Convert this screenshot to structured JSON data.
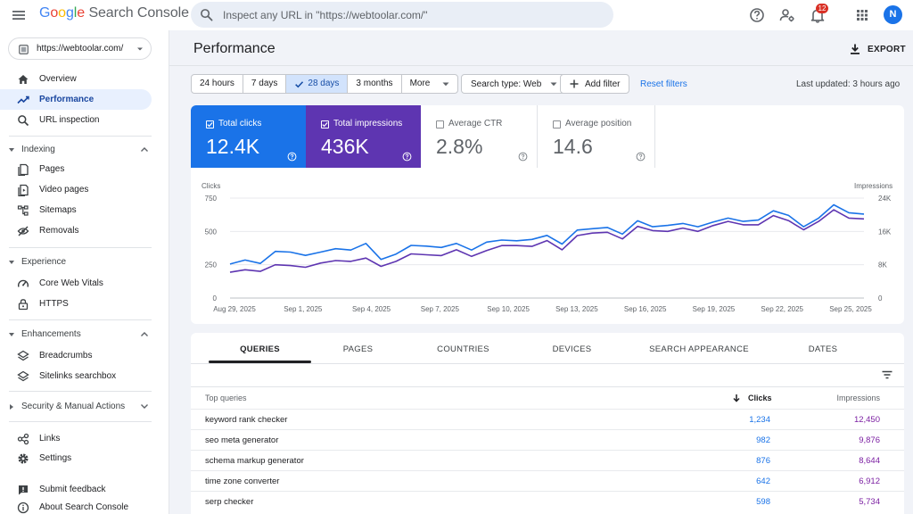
{
  "header": {
    "logo_google": "Google",
    "logo_product": "Search Console",
    "search_placeholder": "Inspect any URL in \"https://webtoolar.com/\"",
    "notification_count": "12",
    "avatar_initial": "N",
    "icons": [
      "menu-icon",
      "search-icon",
      "help-icon",
      "manage-users-icon",
      "bell-icon",
      "apps-grid-icon"
    ]
  },
  "sidebar": {
    "property": "https://webtoolar.com/",
    "top_items": [
      {
        "label": "Overview",
        "icon": "home-icon"
      },
      {
        "label": "Performance",
        "icon": "trending-icon",
        "active": true
      },
      {
        "label": "URL inspection",
        "icon": "search-icon"
      }
    ],
    "sections": [
      {
        "label": "Indexing",
        "items": [
          {
            "label": "Pages",
            "icon": "pages-icon"
          },
          {
            "label": "Video pages",
            "icon": "video-pages-icon"
          },
          {
            "label": "Sitemaps",
            "icon": "sitemap-icon"
          },
          {
            "label": "Removals",
            "icon": "removals-icon"
          }
        ]
      },
      {
        "label": "Experience",
        "items": [
          {
            "label": "Core Web Vitals",
            "icon": "speed-icon"
          },
          {
            "label": "HTTPS",
            "icon": "lock-icon"
          }
        ]
      },
      {
        "label": "Enhancements",
        "items": [
          {
            "label": "Breadcrumbs",
            "icon": "layers-icon"
          },
          {
            "label": "Sitelinks searchbox",
            "icon": "layers-icon"
          }
        ]
      },
      {
        "label": "Security & Manual Actions",
        "items": []
      }
    ],
    "bottom_items": [
      {
        "label": "Links",
        "icon": "links-icon"
      },
      {
        "label": "Settings",
        "icon": "gear-icon"
      }
    ],
    "footer_items": [
      {
        "label": "Submit feedback",
        "icon": "feedback-icon"
      },
      {
        "label": "About Search Console",
        "icon": "info-icon"
      }
    ]
  },
  "main": {
    "title": "Performance",
    "export_label": "EXPORT",
    "date_ranges": [
      "24 hours",
      "7 days",
      "28 days",
      "3 months",
      "More"
    ],
    "selected_range": "28 days",
    "search_type": "Search type: Web",
    "add_filter": "Add filter",
    "reset_filters": "Reset filters",
    "last_updated": "Last updated: 3 hours ago"
  },
  "metrics": [
    {
      "label": "Total clicks",
      "value": "12.4K",
      "checked": true,
      "color": "#1a73e8"
    },
    {
      "label": "Total impressions",
      "value": "436K",
      "checked": true,
      "color": "#5e35b1"
    },
    {
      "label": "Average CTR",
      "value": "2.8%",
      "checked": false,
      "color": ""
    },
    {
      "label": "Average position",
      "value": "14.6",
      "checked": false,
      "color": ""
    }
  ],
  "chart_data": {
    "type": "line",
    "left_axis_title": "Clicks",
    "right_axis_title": "Impressions",
    "left_ticks": [
      "750",
      "500",
      "250",
      "0"
    ],
    "left_ylim": [
      0,
      750
    ],
    "right_ticks": [
      "24K",
      "16K",
      "8K",
      "0"
    ],
    "right_ylim": [
      0,
      24000
    ],
    "x_labels": [
      "Aug 29, 2025",
      "Sep 1, 2025",
      "Sep 4, 2025",
      "Sep 7, 2025",
      "Sep 10, 2025",
      "Sep 13, 2025",
      "Sep 16, 2025",
      "Sep 19, 2025",
      "Sep 22, 2025",
      "Sep 25, 2025"
    ],
    "x": [
      "Aug 29, 2025",
      "Aug 30, 2025",
      "Aug 31, 2025",
      "Sep 1, 2025",
      "Sep 2, 2025",
      "Sep 3, 2025",
      "Sep 4, 2025",
      "Sep 5, 2025",
      "Sep 6, 2025",
      "Sep 7, 2025",
      "Sep 8, 2025",
      "Sep 9, 2025",
      "Sep 10, 2025",
      "Sep 11, 2025",
      "Sep 12, 2025",
      "Sep 13, 2025",
      "Sep 14, 2025",
      "Sep 15, 2025",
      "Sep 16, 2025",
      "Sep 17, 2025",
      "Sep 18, 2025",
      "Sep 19, 2025",
      "Sep 20, 2025",
      "Sep 21, 2025",
      "Sep 22, 2025",
      "Sep 23, 2025",
      "Sep 24, 2025",
      "Sep 25, 2025",
      "Sep 26, 2025"
    ],
    "series": [
      {
        "name": "Clicks",
        "axis": "left",
        "color": "#1a73e8",
        "values": [
          255,
          285,
          260,
          350,
          345,
          320,
          345,
          370,
          360,
          410,
          290,
          330,
          395,
          390,
          380,
          410,
          360,
          420,
          435,
          430,
          440,
          470,
          405,
          510,
          520,
          530,
          480,
          580,
          535,
          545,
          560,
          535,
          570,
          600,
          575,
          585,
          655,
          620,
          535,
          600,
          700,
          640,
          630
        ]
      },
      {
        "name": "Impressions",
        "axis": "right",
        "color": "#5e35b1",
        "values": [
          6200,
          6800,
          6400,
          8000,
          7800,
          7400,
          8400,
          9000,
          8800,
          9600,
          7600,
          8800,
          10600,
          10400,
          10200,
          11600,
          10000,
          11400,
          12600,
          12600,
          12400,
          13800,
          11600,
          15000,
          15600,
          15800,
          14200,
          17200,
          16200,
          16000,
          16800,
          16000,
          17400,
          18400,
          17600,
          17600,
          19800,
          18600,
          16400,
          18400,
          21200,
          19200,
          19000
        ]
      }
    ]
  },
  "table": {
    "tabs": [
      "QUERIES",
      "PAGES",
      "COUNTRIES",
      "DEVICES",
      "SEARCH APPEARANCE",
      "DATES"
    ],
    "active_tab": "QUERIES",
    "col_query": "Top queries",
    "col_clicks": "Clicks",
    "col_impressions": "Impressions",
    "rows": [
      {
        "query": "keyword rank checker",
        "clicks": "1,234",
        "impressions": "12,450"
      },
      {
        "query": "seo meta generator",
        "clicks": "982",
        "impressions": "9,876"
      },
      {
        "query": "schema markup generator",
        "clicks": "876",
        "impressions": "8,644"
      },
      {
        "query": "time zone converter",
        "clicks": "642",
        "impressions": "6,912"
      },
      {
        "query": "serp checker",
        "clicks": "598",
        "impressions": "5,734"
      }
    ]
  }
}
